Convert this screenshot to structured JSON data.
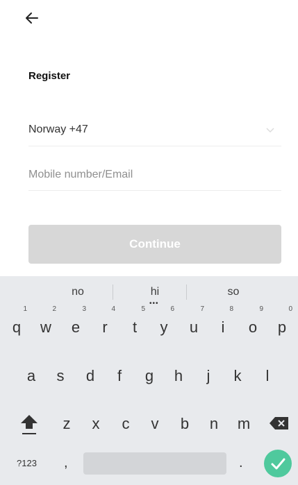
{
  "header": {
    "back_icon": "arrow-left-icon"
  },
  "form": {
    "title": "Register",
    "country_value": "Norway +47",
    "mobile_placeholder": "Mobile number/Email",
    "continue_label": "Continue"
  },
  "keyboard": {
    "suggestions": [
      "no",
      "hi",
      "so"
    ],
    "row1": [
      {
        "k": "q",
        "h": "1"
      },
      {
        "k": "w",
        "h": "2"
      },
      {
        "k": "e",
        "h": "3"
      },
      {
        "k": "r",
        "h": "4"
      },
      {
        "k": "t",
        "h": "5"
      },
      {
        "k": "y",
        "h": "6"
      },
      {
        "k": "u",
        "h": "7"
      },
      {
        "k": "i",
        "h": "8"
      },
      {
        "k": "o",
        "h": "9"
      },
      {
        "k": "p",
        "h": "0"
      }
    ],
    "row2": [
      "a",
      "s",
      "d",
      "f",
      "g",
      "h",
      "j",
      "k",
      "l"
    ],
    "row3": [
      "z",
      "x",
      "c",
      "v",
      "b",
      "n",
      "m"
    ],
    "symbols_label": "?123",
    "comma": ",",
    "period": ".",
    "accent": "#4fc99d"
  }
}
